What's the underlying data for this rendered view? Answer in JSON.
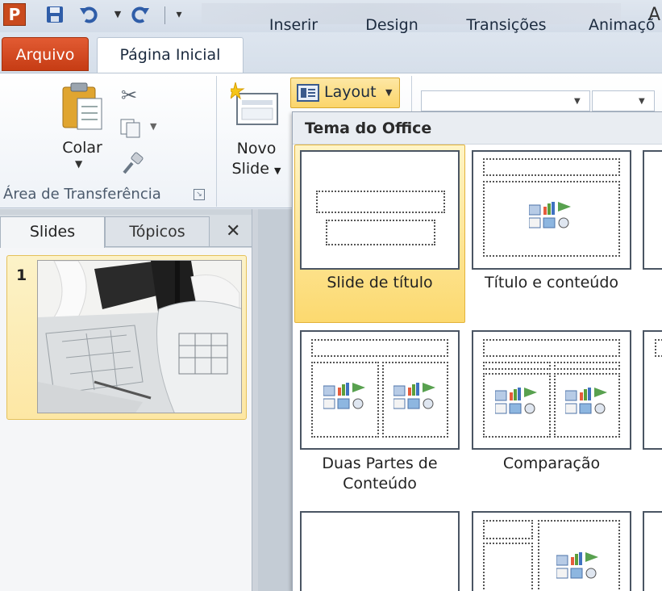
{
  "app": {
    "logo": "P",
    "title_partial": "A"
  },
  "qat": {
    "icons": [
      "save-icon",
      "undo-icon",
      "redo-icon",
      "customize-icon"
    ]
  },
  "tabs": {
    "file": "Arquivo",
    "home": "Página Inicial",
    "insert": "Inserir",
    "design": "Design",
    "transitions": "Transições",
    "animations": "Animaçõ"
  },
  "ribbon": {
    "paste_label": "Colar",
    "clipboard_group": "Área de Transferência",
    "new_slide_label_1": "Novo",
    "new_slide_label_2": "Slide",
    "layout_label": "Layout"
  },
  "panel": {
    "tab_slides": "Slides",
    "tab_topics": "Tópicos",
    "close": "✕",
    "slide_number": "1"
  },
  "gallery": {
    "title": "Tema do Office",
    "layouts": [
      {
        "label": "Slide de título",
        "selected": true
      },
      {
        "label": "Título e conteúdo",
        "selected": false
      },
      {
        "label": "Duas Partes de",
        "label2": "Conteúdo",
        "selected": false
      },
      {
        "label": "Comparação",
        "selected": false
      }
    ]
  },
  "colors": {
    "accent_file": "#d3471d",
    "selected_tile": "#fcd96f",
    "ribbon_bg": "#ffffff"
  }
}
